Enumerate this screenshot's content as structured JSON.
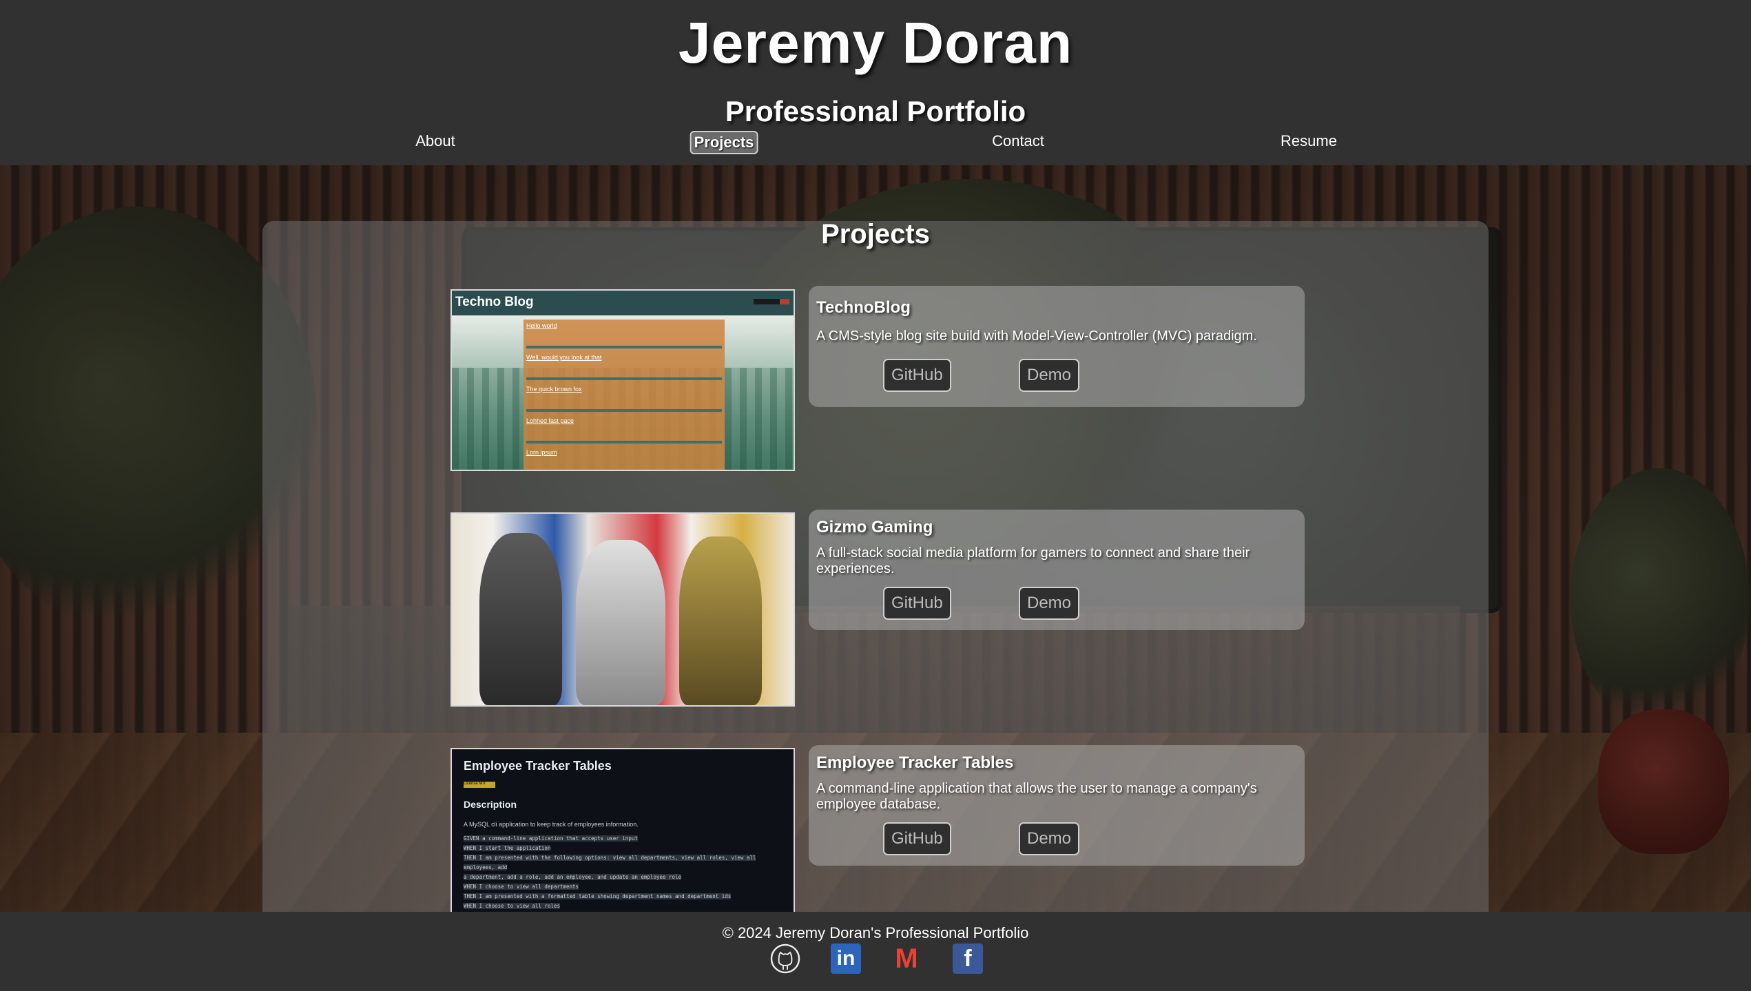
{
  "header": {
    "title": "Jeremy Doran",
    "subtitle": "Professional Portfolio",
    "nav": [
      {
        "label": "About"
      },
      {
        "label": "Projects",
        "active": true
      },
      {
        "label": "Contact"
      },
      {
        "label": "Resume"
      }
    ]
  },
  "projects_section": {
    "title": "Projects",
    "projects": [
      {
        "name": "TechnoBlog",
        "description": "A CMS-style blog site build with Model-View-Controller (MVC) paradigm.",
        "github_label": "GitHub",
        "demo_label": "Demo",
        "screenshot": {
          "header_title": "Techno Blog",
          "posts": [
            "Hello world",
            "Well, would you look at that",
            "The quick brown fox",
            "Lohhed fast pace",
            "Lorn ipsum"
          ]
        }
      },
      {
        "name": "Gizmo Gaming",
        "description": "A full-stack social media platform for gamers to connect and share their experiences.",
        "github_label": "GitHub",
        "demo_label": "Demo"
      },
      {
        "name": "Employee Tracker Tables",
        "description": "A command-line application that allows the user to manage a company's employee database.",
        "github_label": "GitHub",
        "demo_label": "Demo",
        "screenshot": {
          "title": "Employee Tracker Tables",
          "badge": "License MIT",
          "heading": "Description",
          "text": "A MySQL cli application to keep track of employees information.",
          "code_lines": [
            "GIVEN a command-line application that accepts user input",
            "WHEN I start the application",
            "THEN I am presented with the following options: view all departments, view all roles, view all employees, add",
            "a department, add a role, add an employee, and update an employee role",
            "WHEN I choose to view all departments",
            "THEN I am presented with a formatted table showing department names and department ids",
            "WHEN I choose to view all roles"
          ]
        }
      }
    ]
  },
  "footer": {
    "copyright": "© 2024 Jeremy Doran's Professional Portfolio",
    "social": [
      {
        "icon": "github-icon"
      },
      {
        "icon": "linkedin-icon",
        "text": "in"
      },
      {
        "icon": "gmail-icon",
        "text": "M"
      },
      {
        "icon": "facebook-icon",
        "text": "f"
      }
    ]
  },
  "colors": {
    "header_bg": "#313131",
    "panel_overlay": "rgba(110,110,110,0.55)",
    "button_bg": "#2f2f2f",
    "linkedin_blue": "#2d64bc",
    "facebook_blue": "#3b5998"
  }
}
